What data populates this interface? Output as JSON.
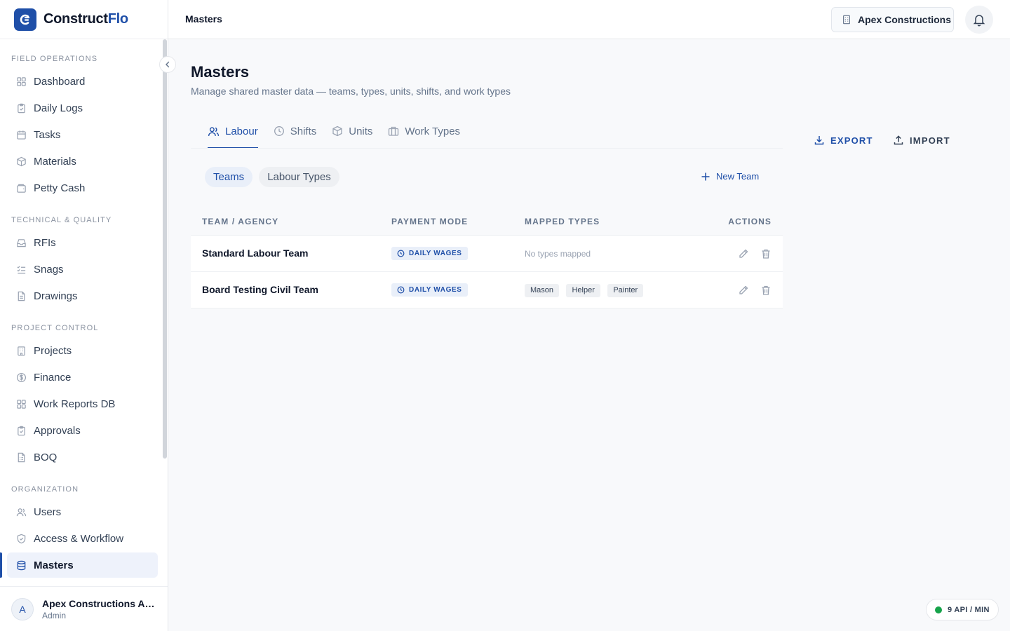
{
  "brand": {
    "name_main": "Construct",
    "name_accent": "Flo"
  },
  "header": {
    "title": "Masters",
    "org_name": "Apex Constructions"
  },
  "sidebar": {
    "sections": [
      {
        "title": "FIELD OPERATIONS",
        "items": [
          {
            "label": "Dashboard",
            "icon": "dashboard-icon"
          },
          {
            "label": "Daily Logs",
            "icon": "clipboard-icon"
          },
          {
            "label": "Tasks",
            "icon": "calendar-icon"
          },
          {
            "label": "Materials",
            "icon": "box-icon"
          },
          {
            "label": "Petty Cash",
            "icon": "wallet-icon"
          }
        ]
      },
      {
        "title": "TECHNICAL & QUALITY",
        "items": [
          {
            "label": "RFIs",
            "icon": "inbox-icon"
          },
          {
            "label": "Snags",
            "icon": "checklist-icon"
          },
          {
            "label": "Drawings",
            "icon": "document-icon"
          }
        ]
      },
      {
        "title": "PROJECT CONTROL",
        "items": [
          {
            "label": "Projects",
            "icon": "building-icon"
          },
          {
            "label": "Finance",
            "icon": "dollar-icon"
          },
          {
            "label": "Work Reports DB",
            "icon": "grid-icon"
          },
          {
            "label": "Approvals",
            "icon": "clipboard-check-icon"
          },
          {
            "label": "BOQ",
            "icon": "sheet-icon"
          }
        ]
      },
      {
        "title": "ORGANIZATION",
        "items": [
          {
            "label": "Users",
            "icon": "users-icon"
          },
          {
            "label": "Access & Workflow",
            "icon": "shield-icon"
          },
          {
            "label": "Masters",
            "icon": "database-icon",
            "active": true
          }
        ]
      }
    ]
  },
  "user": {
    "initial": "A",
    "name": "Apex Constructions Admin",
    "role": "Admin"
  },
  "page": {
    "title": "Masters",
    "subtitle": "Manage shared master data — teams, types, units, shifts, and work types"
  },
  "tabs": [
    {
      "label": "Labour",
      "icon": "users-icon",
      "active": true
    },
    {
      "label": "Shifts",
      "icon": "clock-icon"
    },
    {
      "label": "Units",
      "icon": "cube-icon"
    },
    {
      "label": "Work Types",
      "icon": "briefcase-icon"
    }
  ],
  "actions": {
    "export_label": "EXPORT",
    "import_label": "IMPORT"
  },
  "subtabs": [
    {
      "label": "Teams",
      "active": true
    },
    {
      "label": "Labour Types"
    }
  ],
  "new_team_label": "New Team",
  "table": {
    "headers": [
      "TEAM / AGENCY",
      "PAYMENT MODE",
      "MAPPED TYPES",
      "ACTIONS"
    ],
    "rows": [
      {
        "name": "Standard Labour Team",
        "payment_mode": "DAILY WAGES",
        "empty_text": "No types mapped",
        "types": []
      },
      {
        "name": "Board Testing Civil Team",
        "payment_mode": "DAILY WAGES",
        "empty_text": "",
        "types": [
          "Mason",
          "Helper",
          "Painter"
        ]
      }
    ]
  },
  "api_status": {
    "label": "9 API / MIN",
    "color": "#16a34a"
  },
  "colors": {
    "accent": "#1f4fa8",
    "sidebar_active_bg": "#eef2fb",
    "page_bg": "#f8f9fb"
  }
}
